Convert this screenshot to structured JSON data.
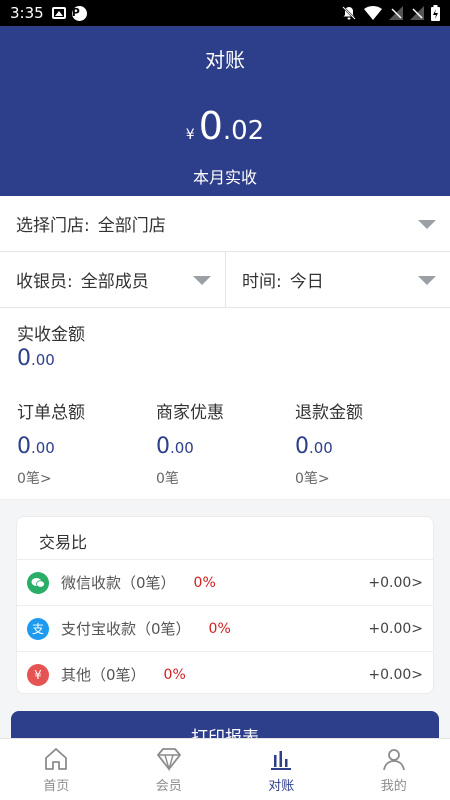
{
  "status_bar": {
    "time": "3:35"
  },
  "header": {
    "title": "对账",
    "currency": "¥",
    "amount_int": "0",
    "amount_dec": ".02",
    "subtitle": "本月实收"
  },
  "filters": {
    "store_label": "选择门店:",
    "store_value": "全部门店",
    "cashier_label": "收银员:",
    "cashier_value": "全部成员",
    "time_label": "时间:",
    "time_value": "今日"
  },
  "summary": {
    "actual_label": "实收金额",
    "actual_int": "0",
    "actual_dec": ".00",
    "order_label": "订单总额",
    "order_int": "0",
    "order_dec": ".00",
    "order_count": "0笔>",
    "merchant_label": "商家优惠",
    "merchant_int": "0",
    "merchant_dec": ".00",
    "merchant_count": "0笔",
    "refund_label": "退款金额",
    "refund_int": "0",
    "refund_dec": ".00",
    "refund_count": "0笔>"
  },
  "transactions": {
    "title": "交易比",
    "items": [
      {
        "name": "微信收款（0笔）",
        "percent": "0%",
        "amount": "+0.00>",
        "icon": "wechat-icon",
        "color": "#2aae67"
      },
      {
        "name": "支付宝收款（0笔）",
        "percent": "0%",
        "amount": "+0.00>",
        "icon": "alipay-icon",
        "color": "#1e9bf0",
        "glyph": "支"
      },
      {
        "name": "其他（0笔）",
        "percent": "0%",
        "amount": "+0.00>",
        "icon": "yen-icon",
        "color": "#e55353",
        "glyph": "¥"
      }
    ]
  },
  "print_button": {
    "label": "打印报表"
  },
  "bottom_nav": [
    {
      "label": "首页",
      "icon": "home-icon"
    },
    {
      "label": "会员",
      "icon": "diamond-icon"
    },
    {
      "label": "对账",
      "icon": "bar-chart-icon",
      "active": true
    },
    {
      "label": "我的",
      "icon": "user-icon"
    }
  ],
  "colors": {
    "primary": "#2d3e8a",
    "percent_red": "#d02020"
  }
}
